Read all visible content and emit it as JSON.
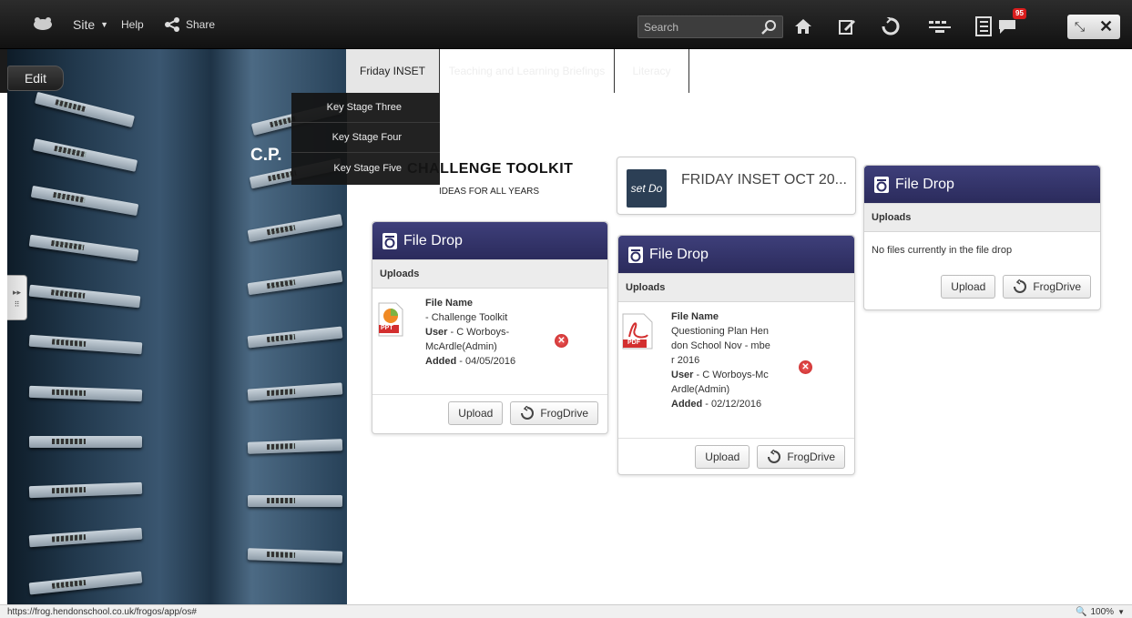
{
  "topbar": {
    "site_label": "Site",
    "help_label": "Help",
    "share_label": "Share",
    "search_placeholder": "Search",
    "notification_count": "95"
  },
  "page": {
    "edit_label": "Edit",
    "tabs": [
      "Friday INSET",
      "Teaching and Learning Briefings",
      "Literacy"
    ],
    "dropdown_items": [
      "Key Stage Three",
      "Key Stage Four",
      "Key Stage Five"
    ],
    "site_title_partial": "C.P.",
    "toolkit_title": "CHALLENGE TOOLKIT",
    "toolkit_subtitle": "IDEAS FOR ALL YEARS"
  },
  "inset_card": {
    "thumb_text": "set Do",
    "title": "FRIDAY INSET OCT 20..."
  },
  "file_drops": [
    {
      "title": "File Drop",
      "uploads_label": "Uploads",
      "file_type": "PPT",
      "file_name_label": "File Name",
      "file_name": "- Challenge Toolkit",
      "user_label": "User",
      "user": "- C Worboys-McArdle(Admin)",
      "added_label": "Added",
      "added": "- 04/05/2016",
      "upload_label": "Upload",
      "frogdrive_label": "FrogDrive"
    },
    {
      "title": "File Drop",
      "uploads_label": "Uploads",
      "file_type": "PDF",
      "file_name_label": "File Name",
      "file_name": "Questioning Plan Hendon School Nov - mber 2016",
      "user_label": "User",
      "user": "- C Worboys-McArdle(Admin)",
      "added_label": "Added",
      "added": "- 02/12/2016",
      "upload_label": "Upload",
      "frogdrive_label": "FrogDrive"
    },
    {
      "title": "File Drop",
      "uploads_label": "Uploads",
      "empty_message": "No files currently in the file drop",
      "upload_label": "Upload",
      "frogdrive_label": "FrogDrive"
    }
  ],
  "statusbar": {
    "url": "https://frog.hendonschool.co.uk/frogos/app/os#",
    "zoom": "100%"
  },
  "colors": {
    "filedrop_header": "#2e2e66",
    "topbar": "#1b1b1b",
    "delete": "#d32f2f",
    "notification_badge": "#d91c1c"
  }
}
